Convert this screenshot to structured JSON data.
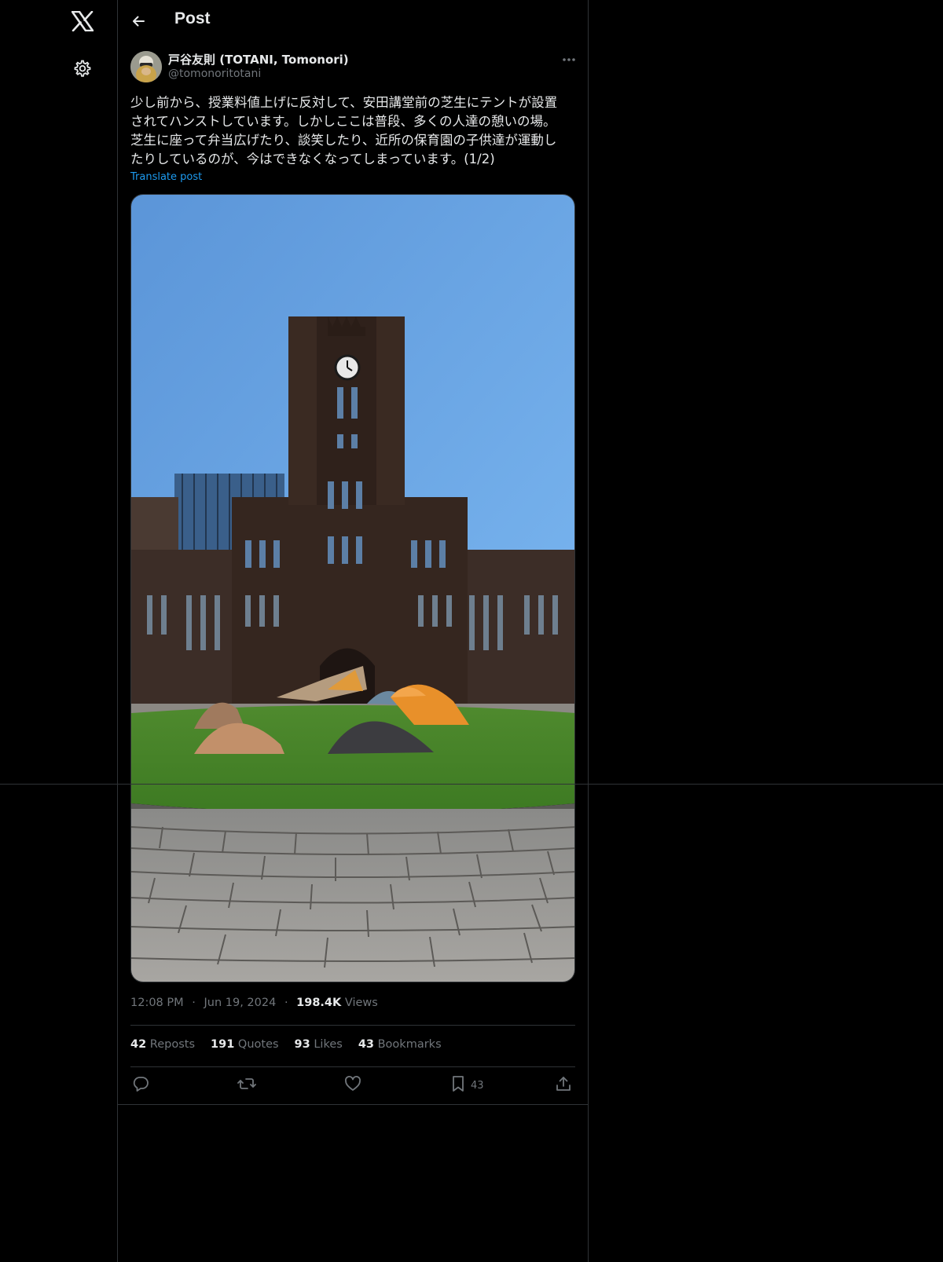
{
  "nav": {
    "logo_icon": "x-logo-icon",
    "settings_icon": "gear-icon"
  },
  "header": {
    "back_icon": "arrow-left-icon",
    "title": "Post"
  },
  "post": {
    "author": {
      "name": "戸谷友則 (TOTANI, Tomonori)",
      "handle": "@tomonoritotani"
    },
    "text": "少し前から、授業料値上げに反対して、安田講堂前の芝生にテントが設置\nされてハンストしています。しかしここは普段、多くの人達の憩いの場。\n芝生に座って弁当広げたり、談笑したり、近所の保育園の子供達が運動し\nたりしているのが、今はできなくなってしまっています。(1/2)",
    "translate_label": "Translate post",
    "time": "12:08 PM",
    "date": "Jun 19, 2024",
    "views_count": "198.4K",
    "views_label": "Views",
    "separator": "·"
  },
  "stats": {
    "reposts": {
      "count": "42",
      "label": "Reposts"
    },
    "quotes": {
      "count": "191",
      "label": "Quotes"
    },
    "likes": {
      "count": "93",
      "label": "Likes"
    },
    "bookmarks": {
      "count": "43",
      "label": "Bookmarks"
    }
  },
  "actions": {
    "reply_icon": "reply-icon",
    "repost_icon": "repost-icon",
    "like_icon": "heart-icon",
    "bookmark_icon": "bookmark-icon",
    "bookmark_count": "43",
    "share_icon": "share-icon"
  },
  "colors": {
    "background": "#000000",
    "border": "#2f3336",
    "text_primary": "#e7e9ea",
    "text_secondary": "#71767b",
    "link": "#1d9bf0"
  }
}
